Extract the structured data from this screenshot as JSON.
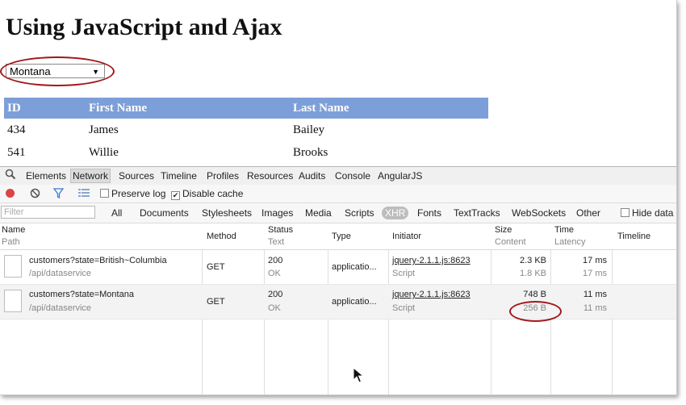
{
  "page": {
    "title": "Using JavaScript and Ajax"
  },
  "state_select": {
    "value": "Montana",
    "arrow": "▼"
  },
  "customers_table": {
    "headers": [
      "ID",
      "First Name",
      "Last Name"
    ],
    "rows": [
      {
        "id": "434",
        "first": "James",
        "last": "Bailey"
      },
      {
        "id": "541",
        "first": "Willie",
        "last": "Brooks"
      }
    ]
  },
  "devtools": {
    "tabs": [
      "Elements",
      "Network",
      "Sources",
      "Timeline",
      "Profiles",
      "Resources",
      "Audits",
      "Console",
      "AngularJS"
    ],
    "active_tab": "Network",
    "toolbar": {
      "preserve_log": "Preserve log",
      "disable_cache": "Disable cache"
    },
    "filter": {
      "placeholder": "Filter",
      "types": [
        "All",
        "Documents",
        "Stylesheets",
        "Images",
        "Media",
        "Scripts",
        "XHR",
        "Fonts",
        "TextTracks",
        "WebSockets",
        "Other"
      ],
      "active_type": "XHR",
      "hide_data": "Hide data"
    },
    "columns": {
      "name": "Name",
      "path": "Path",
      "method": "Method",
      "status": "Status",
      "text": "Text",
      "type": "Type",
      "initiator": "Initiator",
      "size": "Size",
      "content": "Content",
      "time": "Time",
      "latency": "Latency",
      "timeline": "Timeline"
    },
    "requests": [
      {
        "name": "customers?state=British~Columbia",
        "path": "/api/dataservice",
        "method": "GET",
        "status": "200",
        "status_text": "OK",
        "type": "applicatio...",
        "initiator": "jquery-2.1.1.js:8623",
        "initiator_type": "Script",
        "size": "2.3 KB",
        "content": "1.8 KB",
        "time": "17 ms",
        "latency": "17 ms"
      },
      {
        "name": "customers?state=Montana",
        "path": "/api/dataservice",
        "method": "GET",
        "status": "200",
        "status_text": "OK",
        "type": "applicatio...",
        "initiator": "jquery-2.1.1.js:8623",
        "initiator_type": "Script",
        "size": "748 B",
        "content": "256 B",
        "time": "11 ms",
        "latency": "11 ms"
      }
    ]
  }
}
